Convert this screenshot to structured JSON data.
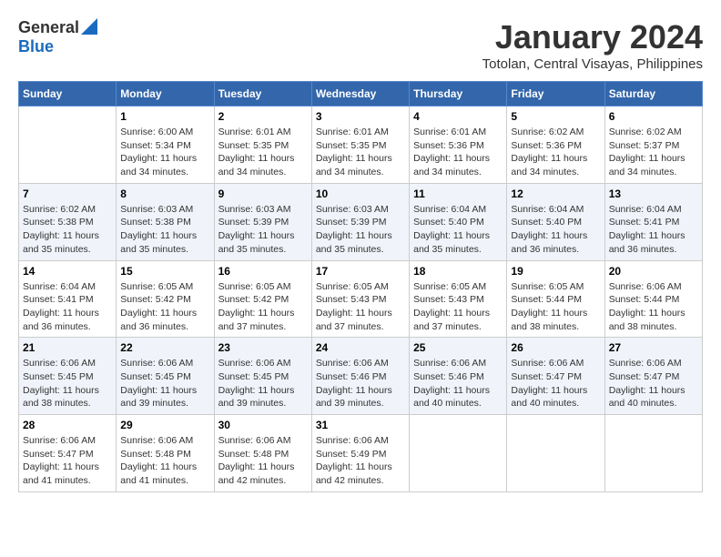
{
  "logo": {
    "general": "General",
    "blue": "Blue"
  },
  "title": "January 2024",
  "location": "Totolan, Central Visayas, Philippines",
  "days_header": [
    "Sunday",
    "Monday",
    "Tuesday",
    "Wednesday",
    "Thursday",
    "Friday",
    "Saturday"
  ],
  "weeks": [
    [
      {
        "day": "",
        "info": ""
      },
      {
        "day": "1",
        "info": "Sunrise: 6:00 AM\nSunset: 5:34 PM\nDaylight: 11 hours\nand 34 minutes."
      },
      {
        "day": "2",
        "info": "Sunrise: 6:01 AM\nSunset: 5:35 PM\nDaylight: 11 hours\nand 34 minutes."
      },
      {
        "day": "3",
        "info": "Sunrise: 6:01 AM\nSunset: 5:35 PM\nDaylight: 11 hours\nand 34 minutes."
      },
      {
        "day": "4",
        "info": "Sunrise: 6:01 AM\nSunset: 5:36 PM\nDaylight: 11 hours\nand 34 minutes."
      },
      {
        "day": "5",
        "info": "Sunrise: 6:02 AM\nSunset: 5:36 PM\nDaylight: 11 hours\nand 34 minutes."
      },
      {
        "day": "6",
        "info": "Sunrise: 6:02 AM\nSunset: 5:37 PM\nDaylight: 11 hours\nand 34 minutes."
      }
    ],
    [
      {
        "day": "7",
        "info": "Sunrise: 6:02 AM\nSunset: 5:38 PM\nDaylight: 11 hours\nand 35 minutes."
      },
      {
        "day": "8",
        "info": "Sunrise: 6:03 AM\nSunset: 5:38 PM\nDaylight: 11 hours\nand 35 minutes."
      },
      {
        "day": "9",
        "info": "Sunrise: 6:03 AM\nSunset: 5:39 PM\nDaylight: 11 hours\nand 35 minutes."
      },
      {
        "day": "10",
        "info": "Sunrise: 6:03 AM\nSunset: 5:39 PM\nDaylight: 11 hours\nand 35 minutes."
      },
      {
        "day": "11",
        "info": "Sunrise: 6:04 AM\nSunset: 5:40 PM\nDaylight: 11 hours\nand 35 minutes."
      },
      {
        "day": "12",
        "info": "Sunrise: 6:04 AM\nSunset: 5:40 PM\nDaylight: 11 hours\nand 36 minutes."
      },
      {
        "day": "13",
        "info": "Sunrise: 6:04 AM\nSunset: 5:41 PM\nDaylight: 11 hours\nand 36 minutes."
      }
    ],
    [
      {
        "day": "14",
        "info": "Sunrise: 6:04 AM\nSunset: 5:41 PM\nDaylight: 11 hours\nand 36 minutes."
      },
      {
        "day": "15",
        "info": "Sunrise: 6:05 AM\nSunset: 5:42 PM\nDaylight: 11 hours\nand 36 minutes."
      },
      {
        "day": "16",
        "info": "Sunrise: 6:05 AM\nSunset: 5:42 PM\nDaylight: 11 hours\nand 37 minutes."
      },
      {
        "day": "17",
        "info": "Sunrise: 6:05 AM\nSunset: 5:43 PM\nDaylight: 11 hours\nand 37 minutes."
      },
      {
        "day": "18",
        "info": "Sunrise: 6:05 AM\nSunset: 5:43 PM\nDaylight: 11 hours\nand 37 minutes."
      },
      {
        "day": "19",
        "info": "Sunrise: 6:05 AM\nSunset: 5:44 PM\nDaylight: 11 hours\nand 38 minutes."
      },
      {
        "day": "20",
        "info": "Sunrise: 6:06 AM\nSunset: 5:44 PM\nDaylight: 11 hours\nand 38 minutes."
      }
    ],
    [
      {
        "day": "21",
        "info": "Sunrise: 6:06 AM\nSunset: 5:45 PM\nDaylight: 11 hours\nand 38 minutes."
      },
      {
        "day": "22",
        "info": "Sunrise: 6:06 AM\nSunset: 5:45 PM\nDaylight: 11 hours\nand 39 minutes."
      },
      {
        "day": "23",
        "info": "Sunrise: 6:06 AM\nSunset: 5:45 PM\nDaylight: 11 hours\nand 39 minutes."
      },
      {
        "day": "24",
        "info": "Sunrise: 6:06 AM\nSunset: 5:46 PM\nDaylight: 11 hours\nand 39 minutes."
      },
      {
        "day": "25",
        "info": "Sunrise: 6:06 AM\nSunset: 5:46 PM\nDaylight: 11 hours\nand 40 minutes."
      },
      {
        "day": "26",
        "info": "Sunrise: 6:06 AM\nSunset: 5:47 PM\nDaylight: 11 hours\nand 40 minutes."
      },
      {
        "day": "27",
        "info": "Sunrise: 6:06 AM\nSunset: 5:47 PM\nDaylight: 11 hours\nand 40 minutes."
      }
    ],
    [
      {
        "day": "28",
        "info": "Sunrise: 6:06 AM\nSunset: 5:47 PM\nDaylight: 11 hours\nand 41 minutes."
      },
      {
        "day": "29",
        "info": "Sunrise: 6:06 AM\nSunset: 5:48 PM\nDaylight: 11 hours\nand 41 minutes."
      },
      {
        "day": "30",
        "info": "Sunrise: 6:06 AM\nSunset: 5:48 PM\nDaylight: 11 hours\nand 42 minutes."
      },
      {
        "day": "31",
        "info": "Sunrise: 6:06 AM\nSunset: 5:49 PM\nDaylight: 11 hours\nand 42 minutes."
      },
      {
        "day": "",
        "info": ""
      },
      {
        "day": "",
        "info": ""
      },
      {
        "day": "",
        "info": ""
      }
    ]
  ]
}
